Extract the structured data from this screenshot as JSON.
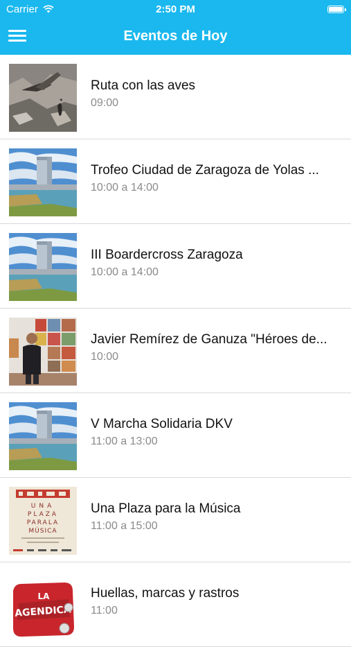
{
  "status": {
    "carrier": "Carrier",
    "time": "2:50 PM"
  },
  "nav": {
    "title": "Eventos de Hoy",
    "menu_icon": "hamburger-menu-icon"
  },
  "events": [
    {
      "title": "Ruta con las aves",
      "time": "09:00"
    },
    {
      "title": "Trofeo Ciudad de Zaragoza de Yolas ...",
      "time": "10:00 a 14:00"
    },
    {
      "title": "III Boardercross Zaragoza",
      "time": "10:00 a 14:00"
    },
    {
      "title": "Javier Remírez de Ganuza \"Héroes de...",
      "time": "10:00"
    },
    {
      "title": "V Marcha Solidaria DKV",
      "time": "11:00 a 13:00"
    },
    {
      "title": "Una Plaza para la Música",
      "time": "11:00 a 15:00"
    },
    {
      "title": "Huellas, marcas y rastros",
      "time": "11:00"
    }
  ],
  "thumb_text": {
    "plaza_poster": "UNA PLAZA PARA LA MÚSICA",
    "agendica_logo": "LA AGENDICA"
  },
  "colors": {
    "accent": "#1ab8ee",
    "title_text": "#111111",
    "time_text": "#8a8a8a",
    "separator": "#d9d9d9"
  }
}
